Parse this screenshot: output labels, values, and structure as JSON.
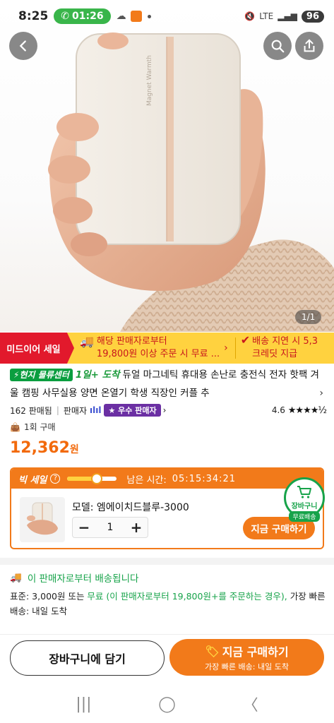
{
  "status_bar": {
    "time": "8:25",
    "call_time": "01:26",
    "battery": "96",
    "network": "LTE"
  },
  "hero": {
    "image_counter": "1/1",
    "product_print": "Magnet Warmth"
  },
  "promo": {
    "tag": "미드이어 세일",
    "item1_line1": "해당 판매자로부터",
    "item1_line2": "19,800원 이상 주문 시 무료 ...",
    "item2_line1": "배송 지연 시 5,3",
    "item2_line2": "크레딧 지급"
  },
  "product": {
    "badge": "현지 물류센터",
    "arrival": "1일+ 도착",
    "title": "듀얼 마그네틱 휴대용 손난로 충전식 전자 핫팩 겨울 캠핑 사무실용 양면 온열기 학생 직장인 커플 추",
    "sold": "162 판매됨",
    "seller_label": "판매자",
    "seller_badge": "우수 판매자",
    "rating": "4.6",
    "stars": "★★★★½",
    "purchase_count": "1회 구매",
    "price": "12,362",
    "price_unit": "원"
  },
  "deal": {
    "label": "빅 세일",
    "timer_label": "남은 시간:",
    "timer": "05:15:34:21",
    "model": "모델: 엠에이치드블루-3000",
    "quantity": "1",
    "buy_now": "지금 구매하기",
    "progress_fraction": 0.6,
    "cart_label": "장바구니",
    "cart_free": "무료배송"
  },
  "shipping": {
    "title": "이 판매자로부터 배송됩니다",
    "desc_prefix": "표준: 3,000원 또는 ",
    "desc_green": "무료 (이 판매자로부터 19,800원+를 주문하는 경우),",
    "desc_suffix": " 가장 빠른 배송: 내일 도착"
  },
  "actions": {
    "add_to_cart": "장바구니에 담기",
    "buy_now": "지금 구매하기",
    "buy_now_sub": "가장 빠른 배송: 내일 도착"
  },
  "colors": {
    "accent": "#f27a1a",
    "green": "#17a34a",
    "promo_red": "#e2192c",
    "promo_yellow": "#ffd23f"
  }
}
